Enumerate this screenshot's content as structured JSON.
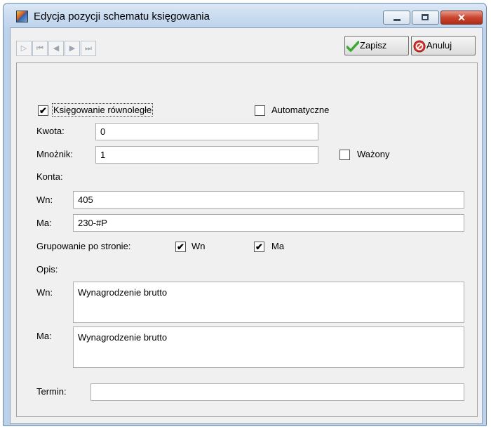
{
  "window": {
    "title": "Edycja pozycji schematu księgowania",
    "minimize_glyph": "",
    "maximize_glyph": "",
    "close_glyph": "✕"
  },
  "toolbar": {
    "nav": [
      {
        "icon": "new-record-icon",
        "glyph": "▷"
      },
      {
        "icon": "first-record-icon",
        "glyph": "⏮"
      },
      {
        "icon": "prev-record-icon",
        "glyph": "◀"
      },
      {
        "icon": "next-record-icon",
        "glyph": "▶"
      },
      {
        "icon": "last-record-icon",
        "glyph": "⏭"
      }
    ],
    "save_label": "Zapisz",
    "cancel_label": "Anuluj"
  },
  "form": {
    "parallel_label": "Księgowanie równoległe",
    "parallel_checked": true,
    "automatic_label": "Automatyczne",
    "automatic_checked": false,
    "amount_label": "Kwota:",
    "amount_value": "0",
    "multiplier_label": "Mnożnik:",
    "multiplier_value": "1",
    "weighted_label": "Ważony",
    "weighted_checked": false,
    "accounts_label": "Konta:",
    "wn_label": "Wn:",
    "wn_value": "405",
    "ma_label": "Ma:",
    "ma_value": "230-#P",
    "grouping_label": "Grupowanie po stronie:",
    "group_wn_label": "Wn",
    "group_wn_checked": true,
    "group_ma_label": "Ma",
    "group_ma_checked": true,
    "description_label": "Opis:",
    "desc_wn_label": "Wn:",
    "desc_wn_value": "Wynagrodzenie brutto",
    "desc_ma_label": "Ma:",
    "desc_ma_value": "Wynagrodzenie brutto",
    "term_label": "Termin:",
    "term_value": ""
  },
  "colors": {
    "save_check": "#3aa832",
    "cancel_icon": "#d9342b"
  }
}
